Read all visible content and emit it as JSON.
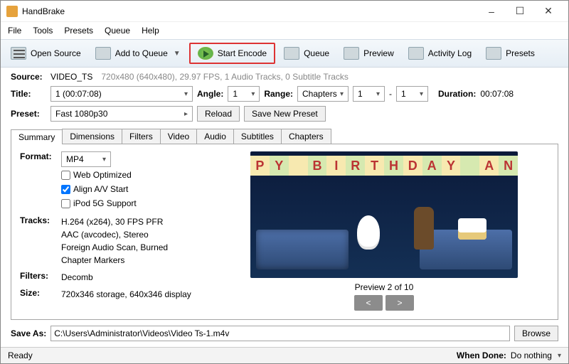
{
  "title": "HandBrake",
  "menu": {
    "file": "File",
    "tools": "Tools",
    "presets": "Presets",
    "queue": "Queue",
    "help": "Help"
  },
  "toolbar": {
    "open_source": "Open Source",
    "add_to_queue": "Add to Queue",
    "start_encode": "Start Encode",
    "queue": "Queue",
    "preview": "Preview",
    "activity_log": "Activity Log",
    "presets": "Presets"
  },
  "source": {
    "label": "Source:",
    "name": "VIDEO_TS",
    "info": "720x480 (640x480), 29.97 FPS, 1 Audio Tracks, 0 Subtitle Tracks"
  },
  "titlebar_row": {
    "title_label": "Title:",
    "title_value": "1  (00:07:08)",
    "angle_label": "Angle:",
    "angle_value": "1",
    "range_label": "Range:",
    "range_mode": "Chapters",
    "range_from": "1",
    "range_sep": "-",
    "range_to": "1",
    "duration_label": "Duration:",
    "duration_value": "00:07:08"
  },
  "preset": {
    "label": "Preset:",
    "value": "Fast 1080p30",
    "reload": "Reload",
    "save": "Save New Preset"
  },
  "tabs": [
    "Summary",
    "Dimensions",
    "Filters",
    "Video",
    "Audio",
    "Subtitles",
    "Chapters"
  ],
  "summary": {
    "format_label": "Format:",
    "format_value": "MP4",
    "web_opt": "Web Optimized",
    "align_av": "Align A/V Start",
    "ipod": "iPod 5G Support",
    "tracks_label": "Tracks:",
    "tracks_lines": [
      "H.264 (x264), 30 FPS PFR",
      "AAC (avcodec), Stereo",
      "Foreign Audio Scan, Burned",
      "Chapter Markers"
    ],
    "filters_label": "Filters:",
    "filters_value": "Decomb",
    "size_label": "Size:",
    "size_value": "720x346 storage, 640x346 display"
  },
  "preview": {
    "banner": [
      "P",
      "Y",
      " ",
      "B",
      "I",
      "R",
      "T",
      "H",
      "D",
      "A",
      "Y",
      " ",
      "A",
      "N"
    ],
    "caption": "Preview 2 of 10",
    "prev": "<",
    "next": ">"
  },
  "saveas": {
    "label": "Save As:",
    "path": "C:\\Users\\Administrator\\Videos\\Video Ts-1.m4v",
    "browse": "Browse"
  },
  "status": {
    "ready": "Ready",
    "when_done_label": "When Done:",
    "when_done_value": "Do nothing"
  }
}
